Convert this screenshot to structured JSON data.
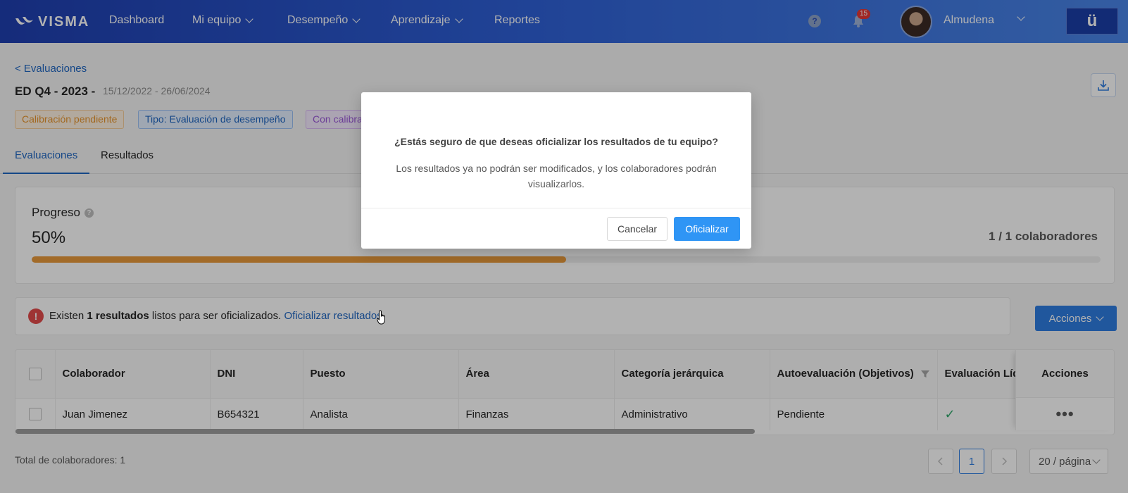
{
  "header": {
    "logo_text": "VISMA",
    "nav": [
      {
        "label": "Dashboard",
        "has_dropdown": false
      },
      {
        "label": "Mi equipo",
        "has_dropdown": true
      },
      {
        "label": "Desempeño",
        "has_dropdown": true
      },
      {
        "label": "Aprendizaje",
        "has_dropdown": true
      },
      {
        "label": "Reportes",
        "has_dropdown": false
      }
    ],
    "help_icon": "question-circle-icon",
    "notifications_count": "15",
    "user_name": "Almudena",
    "brand_button": "ü"
  },
  "page": {
    "back_link": "< Evaluaciones",
    "title": "ED Q4 - 2023 -",
    "dates": "15/12/2022 - 26/06/2024",
    "tags": [
      {
        "label": "Calibración pendiente",
        "color": "#e8962e"
      },
      {
        "label": "Tipo: Evaluación de desempeño",
        "color": "#1f66c2"
      },
      {
        "label": "Con calibración",
        "color": "#9b59d8"
      }
    ],
    "tabs": [
      {
        "label": "Evaluaciones",
        "active": true
      },
      {
        "label": "Resultados",
        "active": false
      }
    ]
  },
  "progress": {
    "label": "Progreso",
    "value_text": "50%",
    "value": 0.5,
    "count": "1 / 1 colaboradores"
  },
  "alert": {
    "prefix": "Existen ",
    "count": "1 resultados",
    "suffix": " listos para ser oficializados. ",
    "link": "Oficializar resultados"
  },
  "actions_button": "Acciones",
  "table": {
    "columns": [
      "Colaborador",
      "DNI",
      "Puesto",
      "Área",
      "Categoría jerárquica",
      "Autoevaluación (Objetivos)",
      "Evaluación Líder"
    ],
    "actions_header": "Acciones",
    "rows": [
      {
        "colaborador": "Juan Jimenez",
        "dni": "B654321",
        "puesto": "Analista",
        "area": "Finanzas",
        "categoria": "Administrativo",
        "autoevaluacion": "Pendiente",
        "evaluacion_lider": "✓",
        "actions": "•••"
      }
    ]
  },
  "footer": {
    "total": "Total de colaboradores: 1",
    "current_page": "1",
    "page_size": "20 / página"
  },
  "modal": {
    "title": "¿Estás seguro de que deseas oficializar los resultados de tu equipo?",
    "body": "Los resultados ya no podrán ser modificados, y los colaboradores podrán visualizarlos.",
    "cancel": "Cancelar",
    "confirm": "Oficializar"
  },
  "colors": {
    "nav_gradient_start": "#1f3fb0",
    "nav_gradient_end": "#4a86e8",
    "primary": "#2f7de1",
    "progress_fill": "#e89a3c"
  }
}
